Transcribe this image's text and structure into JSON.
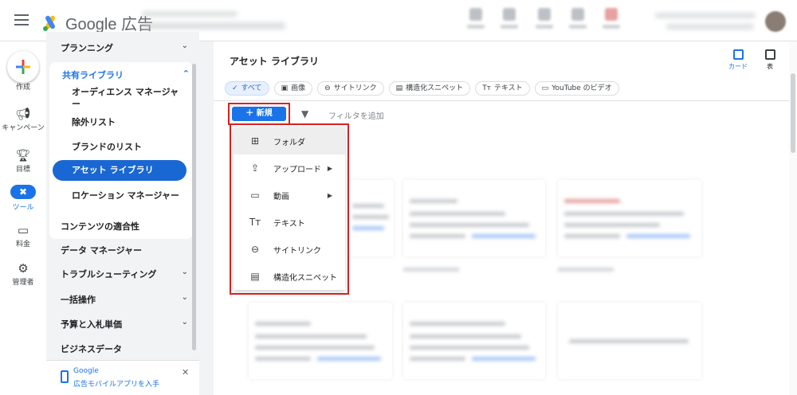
{
  "app": {
    "logo_text": "Google 広告"
  },
  "rail": {
    "create": "作成",
    "campaigns": "キャンペーン",
    "goals": "目標",
    "tools": "ツール",
    "billing": "料金",
    "admin": "管理者"
  },
  "nav": {
    "planning": "プランニング",
    "shared_library": "共有ライブラリ",
    "shared_items": [
      "オーディエンス マネージャー",
      "除外リスト",
      "ブランドのリスト",
      "アセット ライブラリ",
      "ロケーション マネージャー"
    ],
    "content_suitability": "コンテンツの適合性",
    "data_manager": "データ マネージャー",
    "troubleshooting": "トラブルシューティング",
    "bulk_actions": "一括操作",
    "budgets_bidding": "予算と入札単価",
    "business_data": "ビジネスデータ"
  },
  "promo": {
    "line1": "Google",
    "line2": "広告モバイルアプリを入手"
  },
  "main": {
    "title": "アセット ライブラリ",
    "view_card": "カード",
    "view_table": "表",
    "chips": [
      "すべて",
      "画像",
      "サイトリンク",
      "構造化スニペット",
      "テキスト",
      "YouTube のビデオ"
    ],
    "new_button": "新規",
    "filter_placeholder": "フィルタを追加"
  },
  "menu": {
    "items": [
      "フォルダ",
      "アップロード",
      "動画",
      "テキスト",
      "サイトリンク",
      "構造化スニペット"
    ]
  },
  "colors": {
    "accent": "#1a73e8",
    "highlight": "#e02020"
  }
}
